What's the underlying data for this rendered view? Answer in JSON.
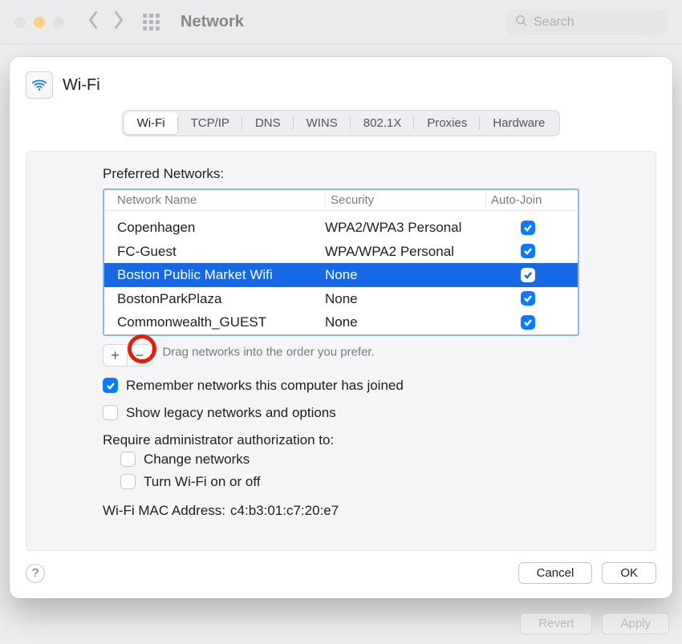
{
  "toolbar": {
    "title": "Network",
    "search_placeholder": "Search"
  },
  "sheet": {
    "title": "Wi-Fi",
    "tabs": [
      "Wi-Fi",
      "TCP/IP",
      "DNS",
      "WINS",
      "802.1X",
      "Proxies",
      "Hardware"
    ],
    "active_tab": "Wi-Fi",
    "section_label": "Preferred Networks:",
    "columns": {
      "name": "Network Name",
      "security": "Security",
      "autojoin": "Auto-Join"
    },
    "networks": [
      {
        "name": "Copenhagen",
        "security": "WPA2/WPA3 Personal",
        "autojoin": true,
        "selected": false
      },
      {
        "name": "FC-Guest",
        "security": "WPA/WPA2 Personal",
        "autojoin": true,
        "selected": false
      },
      {
        "name": "Boston Public Market Wifi",
        "security": "None",
        "autojoin": true,
        "selected": true
      },
      {
        "name": "BostonParkPlaza",
        "security": "None",
        "autojoin": true,
        "selected": false
      },
      {
        "name": "Commonwealth_GUEST",
        "security": "None",
        "autojoin": true,
        "selected": false
      }
    ],
    "add_button": "+",
    "remove_button": "−",
    "drag_hint": "Drag networks into the order you prefer.",
    "options": {
      "remember": {
        "label": "Remember networks this computer has joined",
        "checked": true
      },
      "legacy": {
        "label": "Show legacy networks and options",
        "checked": false
      },
      "admin_label": "Require administrator authorization to:",
      "change_net": {
        "label": "Change networks",
        "checked": false
      },
      "turn_wifi": {
        "label": "Turn Wi-Fi on or off",
        "checked": false
      }
    },
    "mac": {
      "label": "Wi-Fi MAC Address:",
      "value": "c4:b3:01:c7:20:e7"
    },
    "footer": {
      "cancel": "Cancel",
      "ok": "OK",
      "help": "?"
    }
  },
  "bg_footer": {
    "revert": "Revert",
    "apply": "Apply"
  }
}
